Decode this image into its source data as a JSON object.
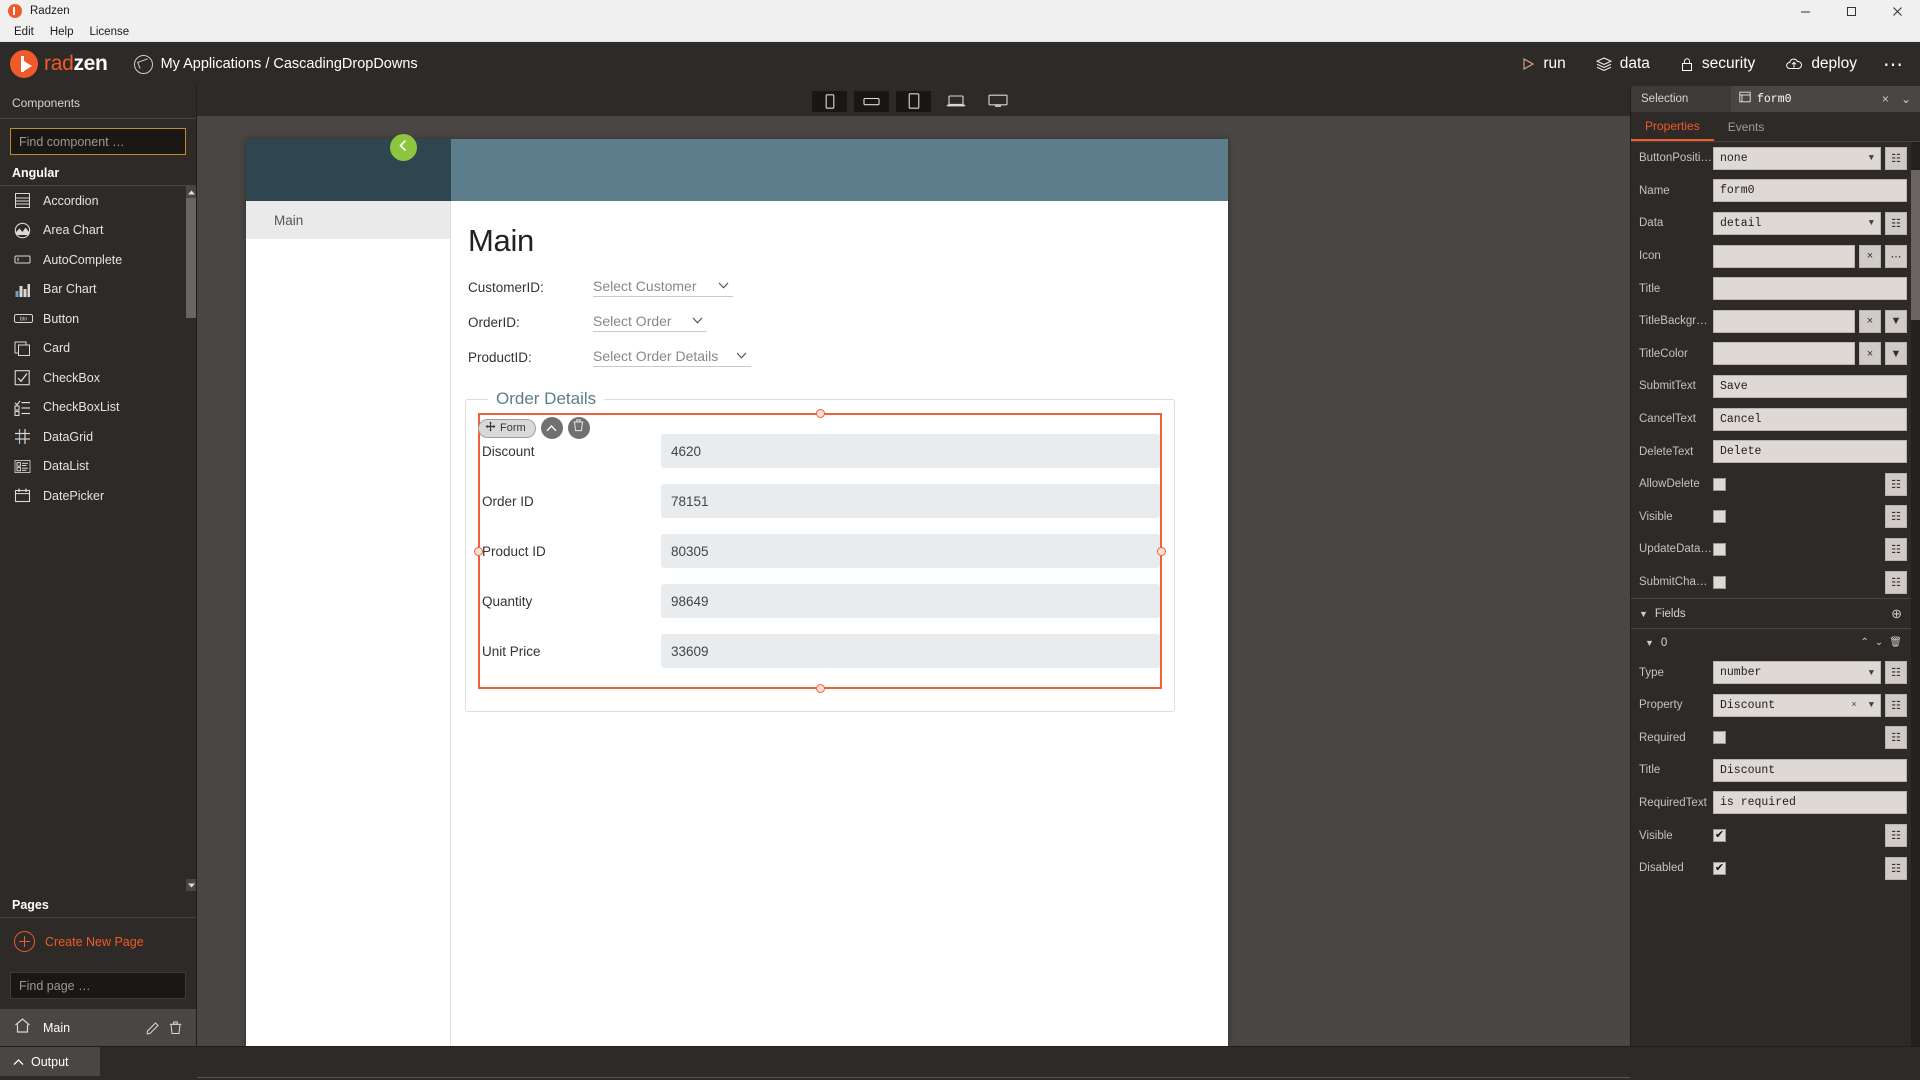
{
  "window": {
    "title": "Radzen",
    "menu": [
      "Edit",
      "Help",
      "License"
    ],
    "controls": {
      "minimize": "─",
      "maximize": "☐",
      "close": "✕"
    }
  },
  "header": {
    "logo_text_a": "rad",
    "logo_text_b": "zen",
    "breadcrumb": "My Applications / CascadingDropDowns",
    "actions": [
      {
        "label": "run",
        "icon": "play-icon"
      },
      {
        "label": "data",
        "icon": "database-icon"
      },
      {
        "label": "security",
        "icon": "lock-icon"
      },
      {
        "label": "deploy",
        "icon": "cloud-icon"
      }
    ],
    "more": "⋯"
  },
  "components_panel": {
    "title": "Components",
    "search_placeholder": "Find component …",
    "search_value": "",
    "group_label": "Angular",
    "items": [
      {
        "label": "Accordion",
        "icon": "accordion-icon"
      },
      {
        "label": "Area Chart",
        "icon": "area-chart-icon"
      },
      {
        "label": "AutoComplete",
        "icon": "autocomplete-icon"
      },
      {
        "label": "Bar Chart",
        "icon": "bar-chart-icon"
      },
      {
        "label": "Button",
        "icon": "button-icon"
      },
      {
        "label": "Card",
        "icon": "card-icon"
      },
      {
        "label": "CheckBox",
        "icon": "checkbox-icon"
      },
      {
        "label": "CheckBoxList",
        "icon": "checkboxlist-icon"
      },
      {
        "label": "DataGrid",
        "icon": "datagrid-icon"
      },
      {
        "label": "DataList",
        "icon": "datalist-icon"
      },
      {
        "label": "DatePicker",
        "icon": "datepicker-icon"
      }
    ]
  },
  "pages_panel": {
    "title": "Pages",
    "create_label": "Create New Page",
    "search_placeholder": "Find page …",
    "search_value": "",
    "pages": [
      {
        "name": "Main",
        "icon": "home-icon"
      }
    ]
  },
  "canvas": {
    "devices": [
      "phone-portrait",
      "phone-landscape",
      "tablet-portrait",
      "laptop",
      "desktop"
    ],
    "menu_toggle_icon": "chevron-left-icon",
    "sidebar_item": "Main",
    "page_title": "Main",
    "fields": [
      {
        "label": "CustomerID:",
        "placeholder": "Select Customer"
      },
      {
        "label": "OrderID:",
        "placeholder": "Select Order"
      },
      {
        "label": "ProductID:",
        "placeholder": "Select Order Details"
      }
    ],
    "fieldset_legend": "Order Details",
    "form_toolbar": {
      "chip_label": "Form",
      "move_icon": "move-icon",
      "up_icon": "chevron-up-icon",
      "delete_icon": "trash-icon"
    },
    "form_rows": [
      {
        "label": "Discount",
        "value": "4620"
      },
      {
        "label": "Order ID",
        "value": "78151"
      },
      {
        "label": "Product ID",
        "value": "80305"
      },
      {
        "label": "Quantity",
        "value": "98649"
      },
      {
        "label": "Unit Price",
        "value": "33609"
      }
    ]
  },
  "inspector": {
    "selection_label": "Selection",
    "selection_value": "form0",
    "selection_icon": "form-icon",
    "close_icon": "×",
    "expand_icon": "⌄",
    "tabs": [
      {
        "label": "Properties",
        "active": true
      },
      {
        "label": "Events",
        "active": false
      }
    ],
    "properties": [
      {
        "name": "ButtonPosition",
        "type": "select",
        "value": "none",
        "has_expr": true
      },
      {
        "name": "Name",
        "type": "text",
        "value": "form0",
        "has_expr": false
      },
      {
        "name": "Data",
        "type": "select",
        "value": "detail",
        "has_expr": true
      },
      {
        "name": "Icon",
        "type": "text",
        "value": "",
        "clear": true,
        "dots": true
      },
      {
        "name": "Title",
        "type": "text",
        "value": "",
        "has_expr": false
      },
      {
        "name": "TitleBackground",
        "type": "text",
        "value": "",
        "clear": true,
        "picker": true
      },
      {
        "name": "TitleColor",
        "type": "text",
        "value": "",
        "clear": true,
        "picker": true
      },
      {
        "name": "SubmitText",
        "type": "text",
        "value": "Save",
        "has_expr": false
      },
      {
        "name": "CancelText",
        "type": "text",
        "value": "Cancel",
        "has_expr": false
      },
      {
        "name": "DeleteText",
        "type": "text",
        "value": "Delete",
        "has_expr": false
      },
      {
        "name": "AllowDelete",
        "type": "checkbox",
        "checked": false,
        "has_expr": true
      },
      {
        "name": "Visible",
        "type": "checkbox",
        "checked": false,
        "has_expr": true
      },
      {
        "name": "UpdateDataOnC...",
        "type": "checkbox",
        "checked": false,
        "has_expr": true
      },
      {
        "name": "SubmitChangesO...",
        "type": "checkbox",
        "checked": false,
        "has_expr": true
      }
    ],
    "fields_group": {
      "label": "Fields",
      "add_icon": "⊕",
      "caret": "▼"
    },
    "field_item": {
      "label": "0",
      "caret": "▼",
      "up": "⌃",
      "down": "⌄",
      "delete": "🗑"
    },
    "field_props": [
      {
        "name": "Type",
        "type": "select",
        "value": "number",
        "has_expr": true
      },
      {
        "name": "Property",
        "type": "select",
        "value": "Discount",
        "clear": true,
        "has_expr": true
      },
      {
        "name": "Required",
        "type": "checkbox",
        "checked": false,
        "has_expr": true
      },
      {
        "name": "Title",
        "type": "text",
        "value": "Discount",
        "has_expr": false
      },
      {
        "name": "RequiredText",
        "type": "text",
        "value": "is required",
        "has_expr": false
      },
      {
        "name": "Visible",
        "type": "checkbox",
        "checked": true,
        "has_expr": true
      },
      {
        "name": "Disabled",
        "type": "checkbox",
        "checked": true,
        "has_expr": true
      }
    ]
  },
  "output": {
    "label": "Output",
    "caret_icon": "chevron-up-icon"
  },
  "colors": {
    "accent": "#f05a28",
    "panel_bg": "#2e2a28",
    "canvas_bg": "#4a4644",
    "selection": "#f0603c",
    "preview_header": "#5c7d8c",
    "legend": "#5c7d8c"
  }
}
